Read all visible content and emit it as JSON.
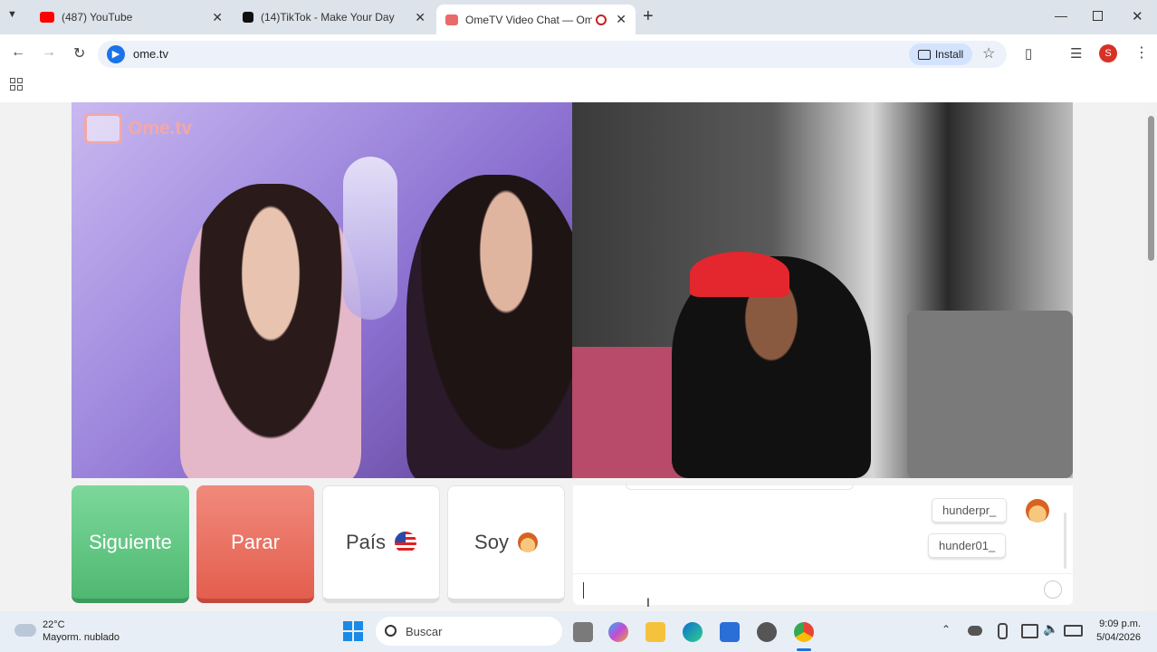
{
  "browser": {
    "tabs": [
      {
        "title": "(487) YouTube",
        "active": false,
        "favicon": "youtube-icon",
        "color": "#ff0000"
      },
      {
        "title": "(14)TikTok - Make Your Day",
        "active": false,
        "favicon": "tiktok-icon",
        "color": "#111111"
      },
      {
        "title": "OmeTV Video Chat — Ome",
        "active": true,
        "favicon": "ometv-icon",
        "color": "#e86a6a"
      }
    ],
    "url": "ome.tv",
    "install_label": "Install",
    "profile_initial": "S",
    "new_tab_symbol": "+"
  },
  "page": {
    "brand_logo": "Ome.tv",
    "brand_tv": "Ome TV",
    "buttons": {
      "next": "Siguiente",
      "stop": "Parar",
      "country": "País",
      "country_flag": "flag-us-icon",
      "i_am": "Soy",
      "i_am_icon": "boy-emoji-icon"
    },
    "chat": {
      "messages": [
        "hunderpr_",
        "hunder01_"
      ],
      "input_value": ""
    },
    "colors": {
      "next": "#5cc57f",
      "stop": "#ec6b5a",
      "accent": "#1a73e8"
    }
  },
  "taskbar": {
    "weather_temp": "22°C",
    "weather_desc": "Mayorm. nublado",
    "search_placeholder": "Buscar",
    "time": "9:09 p.m.",
    "date": "5/04/2026"
  }
}
